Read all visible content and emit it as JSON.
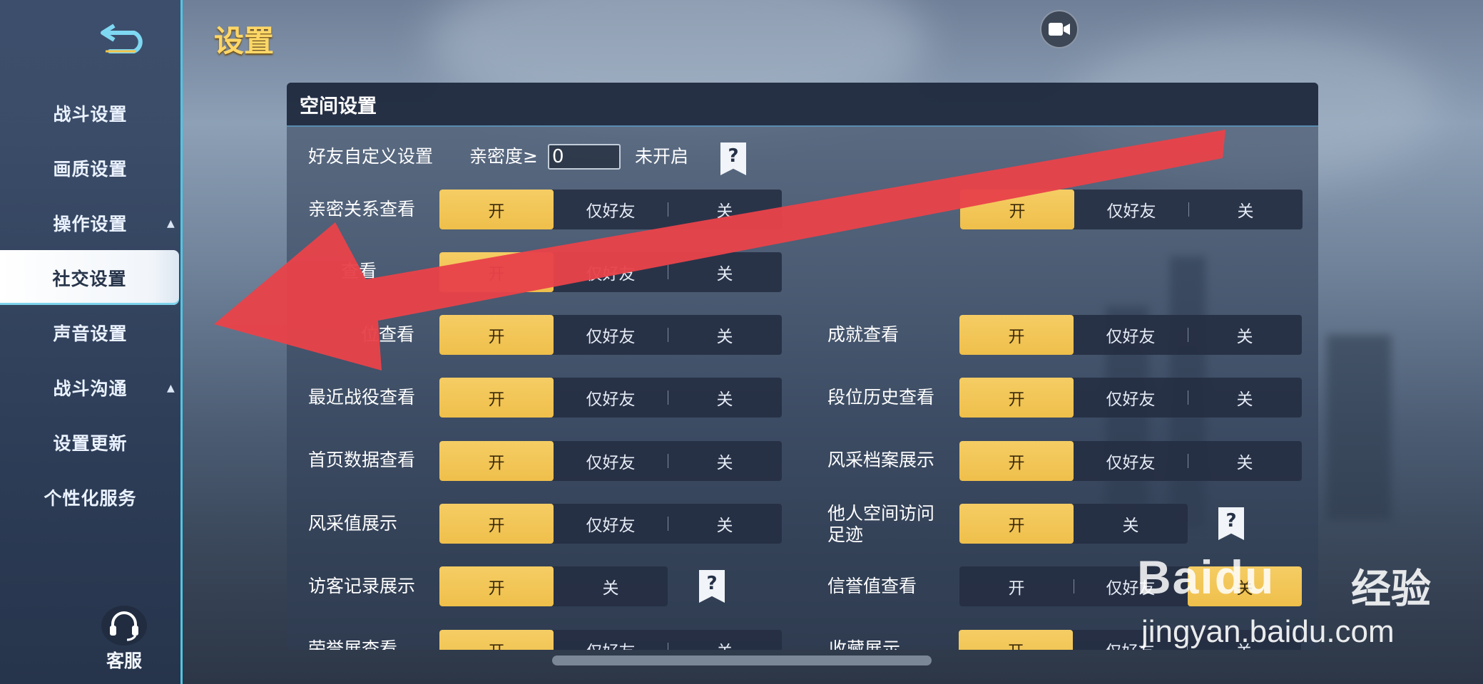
{
  "page": {
    "title": "设置"
  },
  "sidebar": {
    "items": [
      {
        "label": "战斗设置",
        "caret": ""
      },
      {
        "label": "画质设置",
        "caret": ""
      },
      {
        "label": "操作设置",
        "caret": "▲"
      },
      {
        "label": "社交设置",
        "caret": ""
      },
      {
        "label": "声音设置",
        "caret": ""
      },
      {
        "label": "战斗沟通",
        "caret": "▲"
      },
      {
        "label": "设置更新",
        "caret": ""
      },
      {
        "label": "个性化服务",
        "caret": ""
      }
    ],
    "active_index": 3,
    "service_label": "客服"
  },
  "panel": {
    "title": "空间设置",
    "friend_custom": {
      "label": "好友自定义设置",
      "intimacy_label": "亲密度≥",
      "intimacy_value": "0",
      "status": "未开启",
      "help": "?"
    },
    "settings": [
      {
        "label": "亲密关系查看",
        "options": [
          "开",
          "仅好友",
          "关"
        ],
        "selected": "开"
      },
      {
        "label": "",
        "options": [
          "开",
          "仅好友",
          "关"
        ],
        "selected": "开"
      },
      {
        "label": "查看",
        "options": [
          "开",
          "仅好友",
          "关"
        ],
        "selected": "开"
      },
      {
        "label": "位查看",
        "options": [
          "开",
          "仅好友",
          "关"
        ],
        "selected": "开"
      },
      {
        "label": "成就查看",
        "options": [
          "开",
          "仅好友",
          "关"
        ],
        "selected": "开"
      },
      {
        "label": "最近战役查看",
        "options": [
          "开",
          "仅好友",
          "关"
        ],
        "selected": "开"
      },
      {
        "label": "段位历史查看",
        "options": [
          "开",
          "仅好友",
          "关"
        ],
        "selected": "开"
      },
      {
        "label": "首页数据查看",
        "options": [
          "开",
          "仅好友",
          "关"
        ],
        "selected": "开"
      },
      {
        "label": "风采档案展示",
        "options": [
          "开",
          "仅好友",
          "关"
        ],
        "selected": "开"
      },
      {
        "label": "风采值展示",
        "options": [
          "开",
          "仅好友",
          "关"
        ],
        "selected": "开"
      },
      {
        "label": "他人空间访问足迹",
        "options": [
          "开",
          "关"
        ],
        "selected": "开"
      },
      {
        "label": "访客记录展示",
        "options": [
          "开",
          "关"
        ],
        "selected": "开"
      },
      {
        "label": "信誉值查看",
        "options": [
          "开",
          "仅好友",
          "关"
        ],
        "selected": "关"
      },
      {
        "label": "荣誉展查看",
        "options": [
          "开",
          "仅好友",
          "关"
        ],
        "selected": "开"
      },
      {
        "label": "收藏展示",
        "options": [
          "开",
          "仅好友",
          "关"
        ],
        "selected": "开"
      }
    ]
  },
  "watermark": {
    "brand": "Baidu",
    "cn": "经验",
    "url": "jingyan.baidu.com"
  },
  "colors": {
    "accent_on": "#f2c453",
    "arrow": "#e8434a",
    "title": "#ffd766",
    "sidebar_border": "#4fc6e4"
  }
}
